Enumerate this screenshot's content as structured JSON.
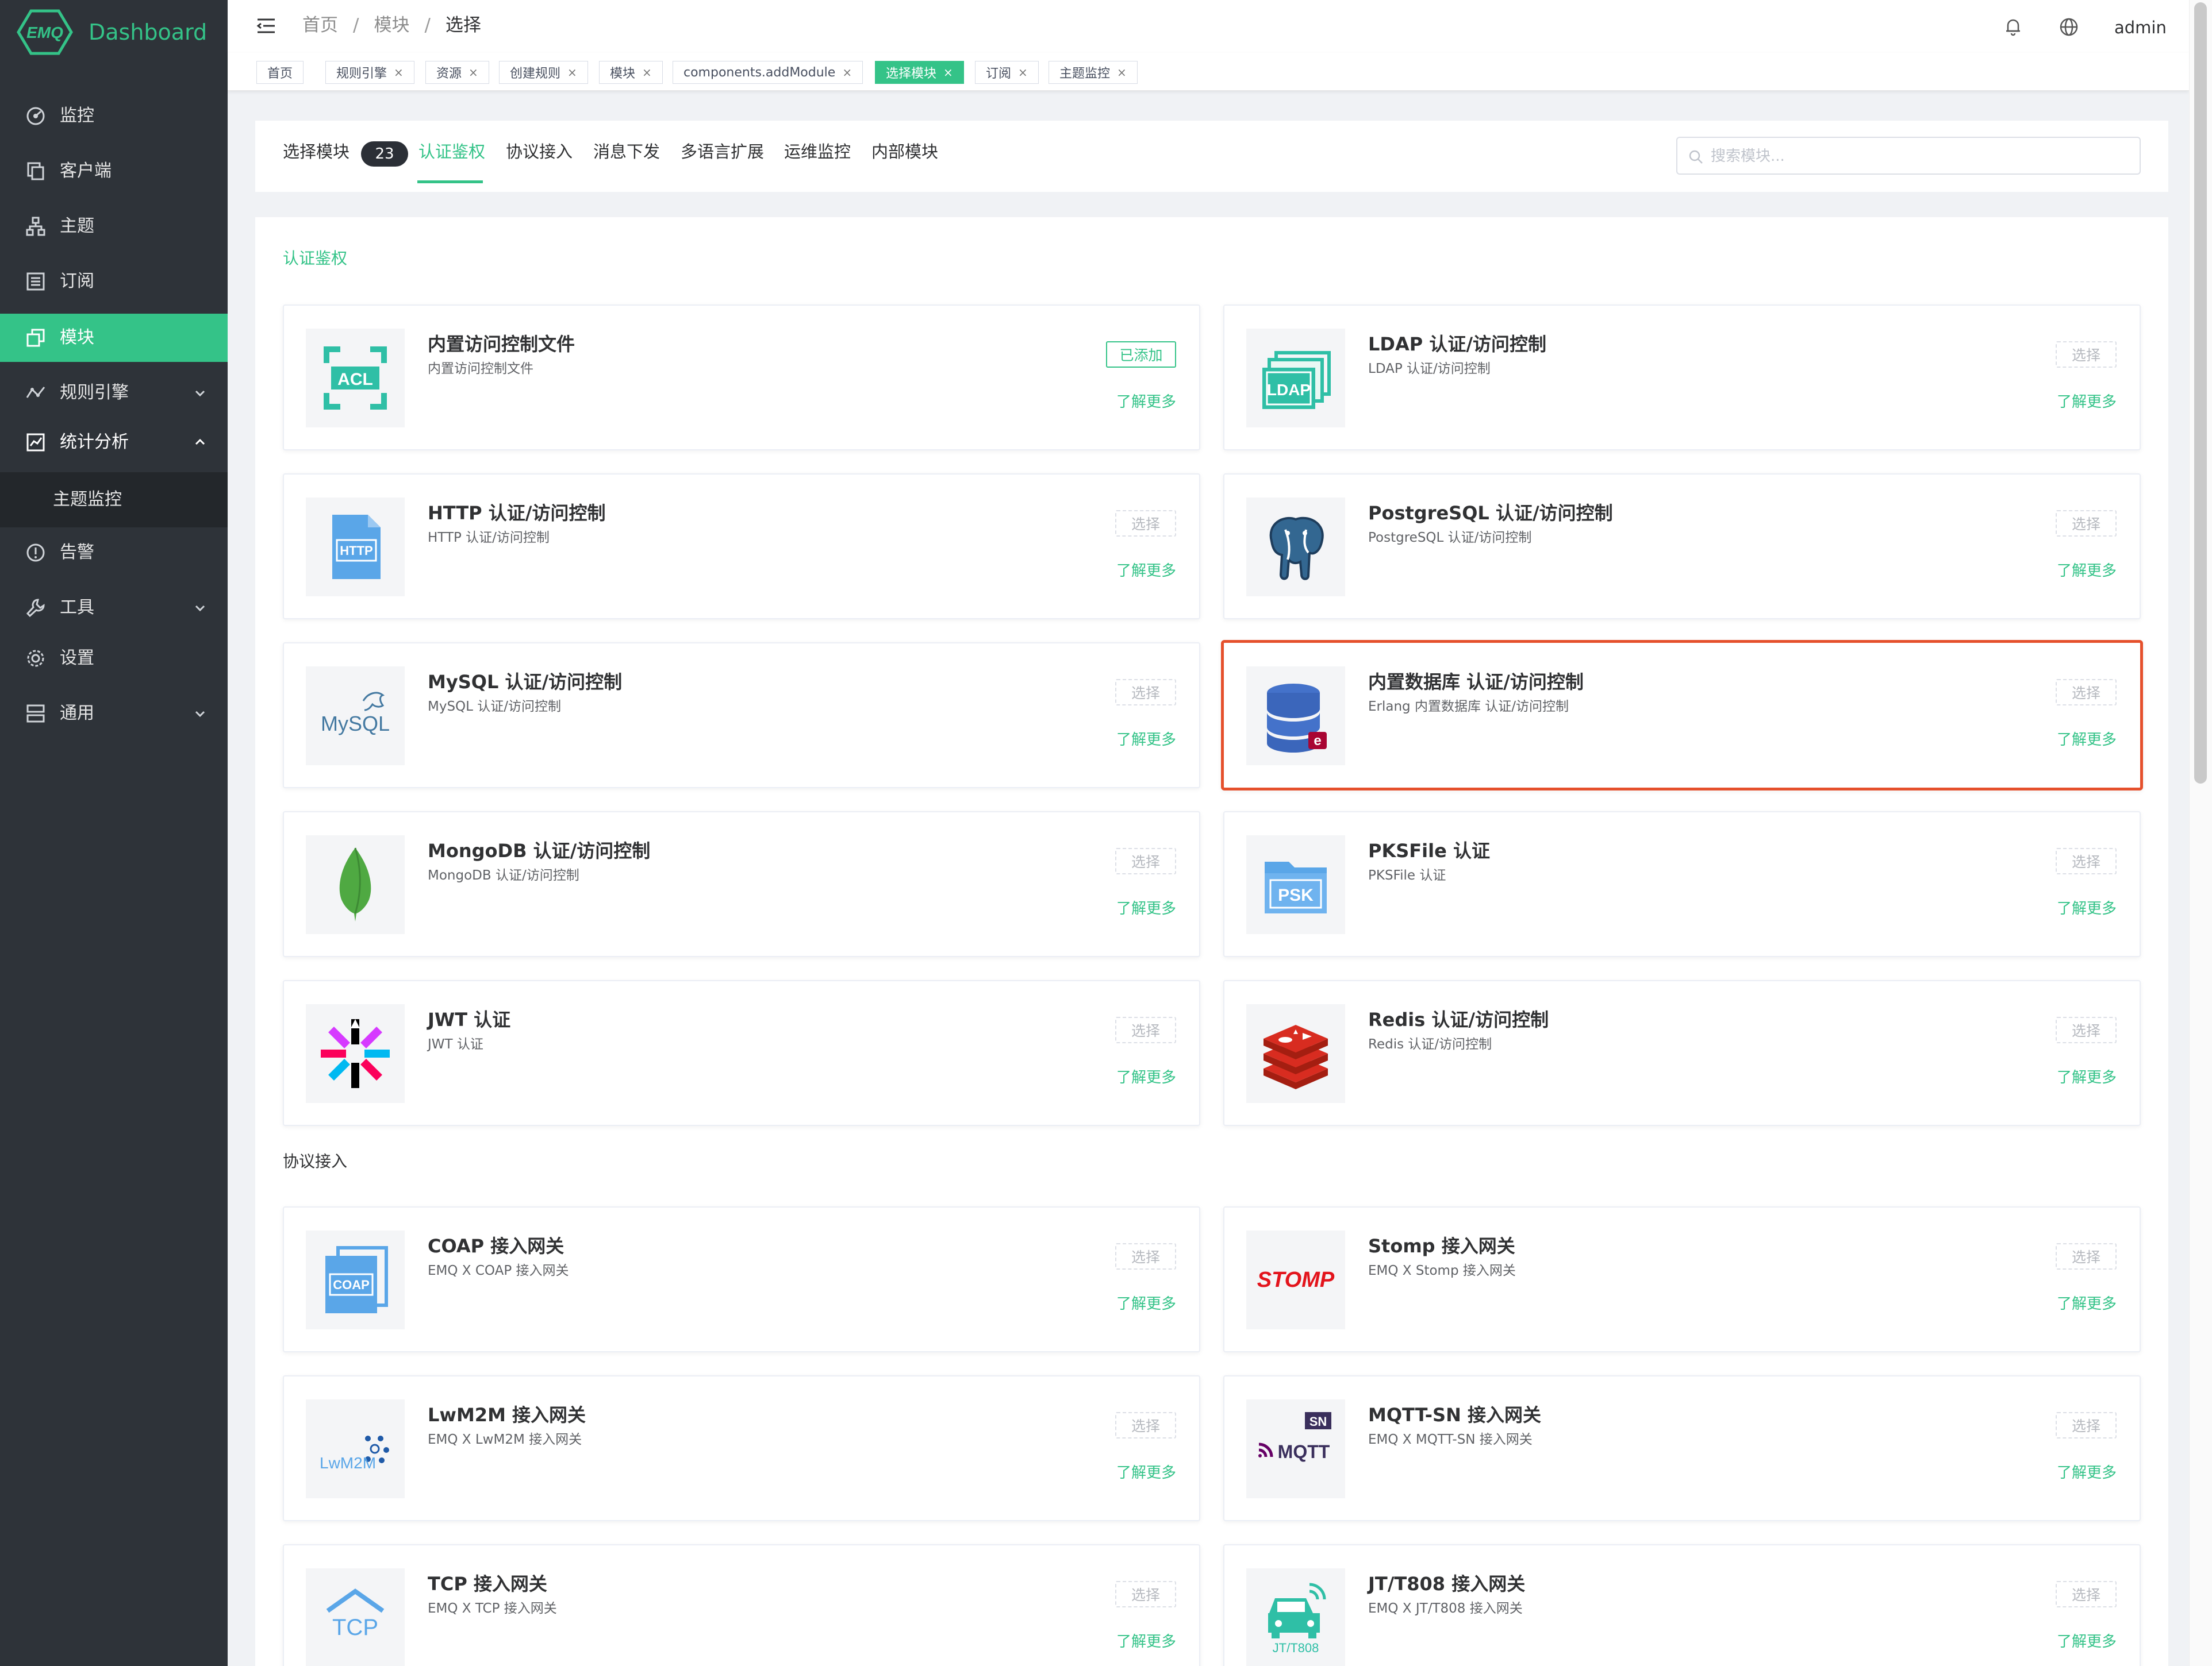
{
  "brand": {
    "logo_text": "EMQ",
    "name": "Dashboard"
  },
  "colors": {
    "accent": "#34c388",
    "sidebar_bg": "#2e3339",
    "highlight": "#e5502c"
  },
  "sidebar": {
    "items": [
      {
        "label": "监控",
        "icon": "monitor-icon"
      },
      {
        "label": "客户端",
        "icon": "clients-icon"
      },
      {
        "label": "主题",
        "icon": "topics-icon"
      },
      {
        "label": "订阅",
        "icon": "subscriptions-icon"
      },
      {
        "label": "模块",
        "icon": "modules-icon",
        "active": true
      },
      {
        "label": "规则引擎",
        "icon": "rule-engine-icon",
        "expandable": true
      },
      {
        "label": "统计分析",
        "icon": "analysis-icon",
        "expanded": true
      },
      {
        "label": "主题监控",
        "submenu": true
      },
      {
        "label": "告警",
        "icon": "alarm-icon"
      },
      {
        "label": "工具",
        "icon": "tools-icon",
        "expandable": true
      },
      {
        "label": "设置",
        "icon": "settings-icon"
      },
      {
        "label": "通用",
        "icon": "general-icon",
        "expandable": true
      }
    ]
  },
  "header": {
    "breadcrumb": [
      "首页",
      "模块",
      "选择"
    ],
    "user": "admin",
    "icons": [
      "menu-toggle-icon",
      "bell-icon",
      "globe-icon"
    ]
  },
  "tags": [
    {
      "label": "首页",
      "closable": false
    },
    {
      "label": "规则引擎",
      "closable": true
    },
    {
      "label": "资源",
      "closable": true
    },
    {
      "label": "创建规则",
      "closable": true
    },
    {
      "label": "模块",
      "closable": true
    },
    {
      "label": "components.addModule",
      "closable": true
    },
    {
      "label": "选择模块",
      "closable": true,
      "active": true
    },
    {
      "label": "订阅",
      "closable": true
    },
    {
      "label": "主题监控",
      "closable": true
    }
  ],
  "tab_bar": {
    "title": "选择模块",
    "count": "23",
    "tabs": [
      "认证鉴权",
      "协议接入",
      "消息下发",
      "多语言扩展",
      "运维监控",
      "内部模块"
    ],
    "active_tab": "认证鉴权",
    "search_placeholder": "搜索模块..."
  },
  "sections": [
    {
      "title": "认证鉴权",
      "modules": [
        {
          "title": "内置访问控制文件",
          "desc": "内置访问控制文件",
          "action": "已添加",
          "added": true,
          "more": "了解更多",
          "icon": "acl-icon"
        },
        {
          "title": "LDAP 认证/访问控制",
          "desc": "LDAP 认证/访问控制",
          "action": "选择",
          "more": "了解更多",
          "icon": "ldap-icon"
        },
        {
          "title": "HTTP 认证/访问控制",
          "desc": "HTTP 认证/访问控制",
          "action": "选择",
          "more": "了解更多",
          "icon": "http-icon"
        },
        {
          "title": "PostgreSQL 认证/访问控制",
          "desc": "PostgreSQL 认证/访问控制",
          "action": "选择",
          "more": "了解更多",
          "icon": "postgresql-icon"
        },
        {
          "title": "MySQL 认证/访问控制",
          "desc": "MySQL 认证/访问控制",
          "action": "选择",
          "more": "了解更多",
          "icon": "mysql-icon"
        },
        {
          "title": "内置数据库 认证/访问控制",
          "desc": "Erlang 内置数据库 认证/访问控制",
          "action": "选择",
          "more": "了解更多",
          "icon": "builtin-database-icon",
          "highlighted": true
        },
        {
          "title": "MongoDB 认证/访问控制",
          "desc": "MongoDB 认证/访问控制",
          "action": "选择",
          "more": "了解更多",
          "icon": "mongodb-icon"
        },
        {
          "title": "PKSFile 认证",
          "desc": "PKSFile 认证",
          "action": "选择",
          "more": "了解更多",
          "icon": "psk-icon"
        },
        {
          "title": "JWT 认证",
          "desc": "JWT 认证",
          "action": "选择",
          "more": "了解更多",
          "icon": "jwt-icon"
        },
        {
          "title": "Redis 认证/访问控制",
          "desc": "Redis 认证/访问控制",
          "action": "选择",
          "more": "了解更多",
          "icon": "redis-icon"
        }
      ]
    },
    {
      "title": "协议接入",
      "modules": [
        {
          "title": "COAP 接入网关",
          "desc": "EMQ X COAP 接入网关",
          "action": "选择",
          "more": "了解更多",
          "icon": "coap-icon"
        },
        {
          "title": "Stomp 接入网关",
          "desc": "EMQ X Stomp 接入网关",
          "action": "选择",
          "more": "了解更多",
          "icon": "stomp-icon"
        },
        {
          "title": "LwM2M 接入网关",
          "desc": "EMQ X LwM2M 接入网关",
          "action": "选择",
          "more": "了解更多",
          "icon": "lwm2m-icon"
        },
        {
          "title": "MQTT-SN 接入网关",
          "desc": "EMQ X MQTT-SN 接入网关",
          "action": "选择",
          "more": "了解更多",
          "icon": "mqtt-sn-icon"
        },
        {
          "title": "TCP 接入网关",
          "desc": "EMQ X TCP 接入网关",
          "action": "选择",
          "more": "了解更多",
          "icon": "tcp-icon"
        },
        {
          "title": "JT/T808 接入网关",
          "desc": "EMQ X JT/T808 接入网关",
          "action": "选择",
          "more": "了解更多",
          "icon": "jt808-icon"
        }
      ]
    }
  ],
  "logo_texts": {
    "acl": "ACL",
    "ldap": "LDAP",
    "http": "HTTP",
    "mysql": "MySQL",
    "psk": "PSK",
    "coap": "COAP",
    "stomp": "STOMP",
    "lwm2m": "LwM2M",
    "mqttsn_badge": "SN",
    "mqtt": "MQTT",
    "tcp": "TCP",
    "jt808": "JT/T808"
  }
}
